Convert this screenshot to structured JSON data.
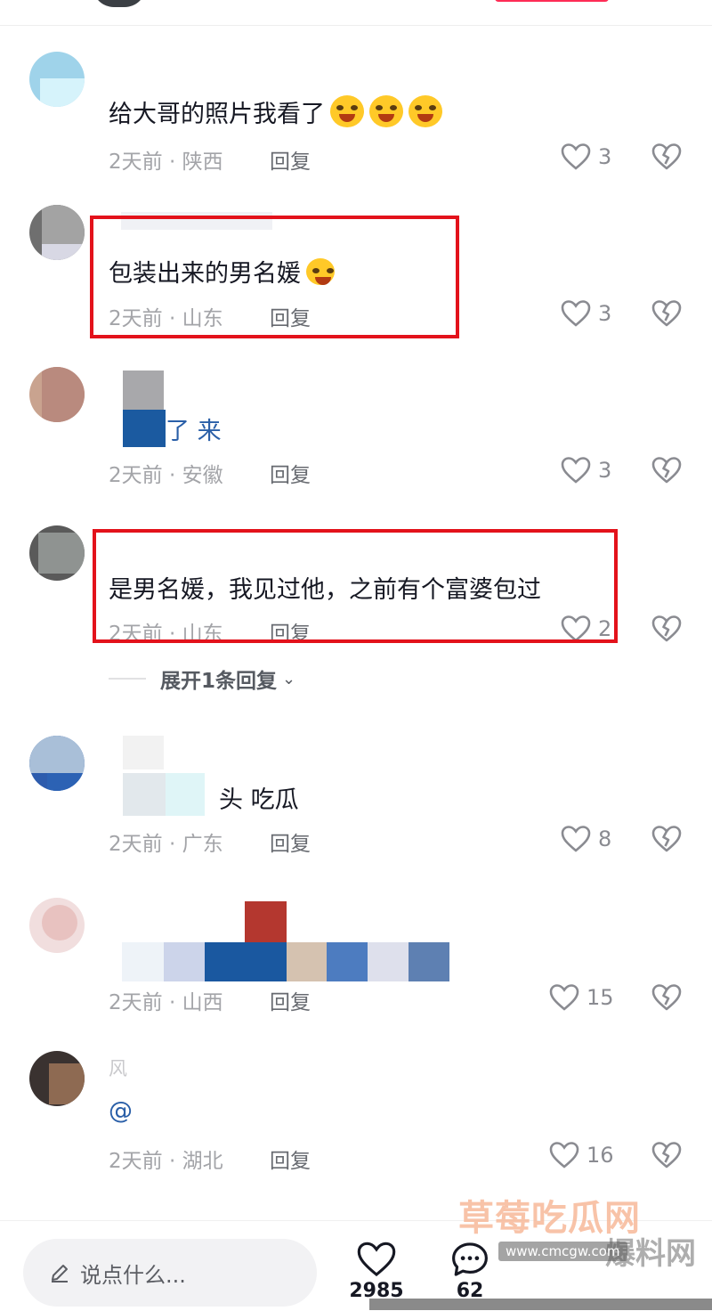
{
  "comments": [
    {
      "username": "",
      "text": "给大哥的照片我看了",
      "time": "2天前",
      "location": "陕西",
      "reply_label": "回复",
      "likes": "3"
    },
    {
      "username": "",
      "text": "包装出来的男名媛",
      "time": "2天前",
      "location": "山东",
      "reply_label": "回复",
      "likes": "3"
    },
    {
      "username": "",
      "text": "了 来",
      "time": "2天前",
      "location": "安徽",
      "reply_label": "回复",
      "likes": "3"
    },
    {
      "username": "",
      "text": "是男名媛，我见过他，之前有个富婆包过",
      "time": "2天前",
      "location": "山东",
      "reply_label": "回复",
      "likes": "2"
    },
    {
      "username": "",
      "text": "头 吃瓜",
      "time": "2天前",
      "location": "广东",
      "reply_label": "回复",
      "likes": "8"
    },
    {
      "username": "",
      "text": "",
      "time": "2天前",
      "location": "山西",
      "reply_label": "回复",
      "likes": "15"
    },
    {
      "username": "风",
      "text": "@",
      "time": "2天前",
      "location": "湖北",
      "reply_label": "回复",
      "likes": "16"
    }
  ],
  "meta_separator": " · ",
  "expand_replies": "展开1条回复",
  "bottom": {
    "input_placeholder": "说点什么...",
    "like_count": "2985",
    "comment_count": "62"
  },
  "watermark": {
    "main": "草莓吃瓜网",
    "sub": "爆料网",
    "url": "www.cmcgw.com"
  },
  "colors": {
    "highlight": "#e3121b",
    "text": "#161823",
    "meta": "#a3a4a8",
    "mention": "#2a5fa8"
  }
}
